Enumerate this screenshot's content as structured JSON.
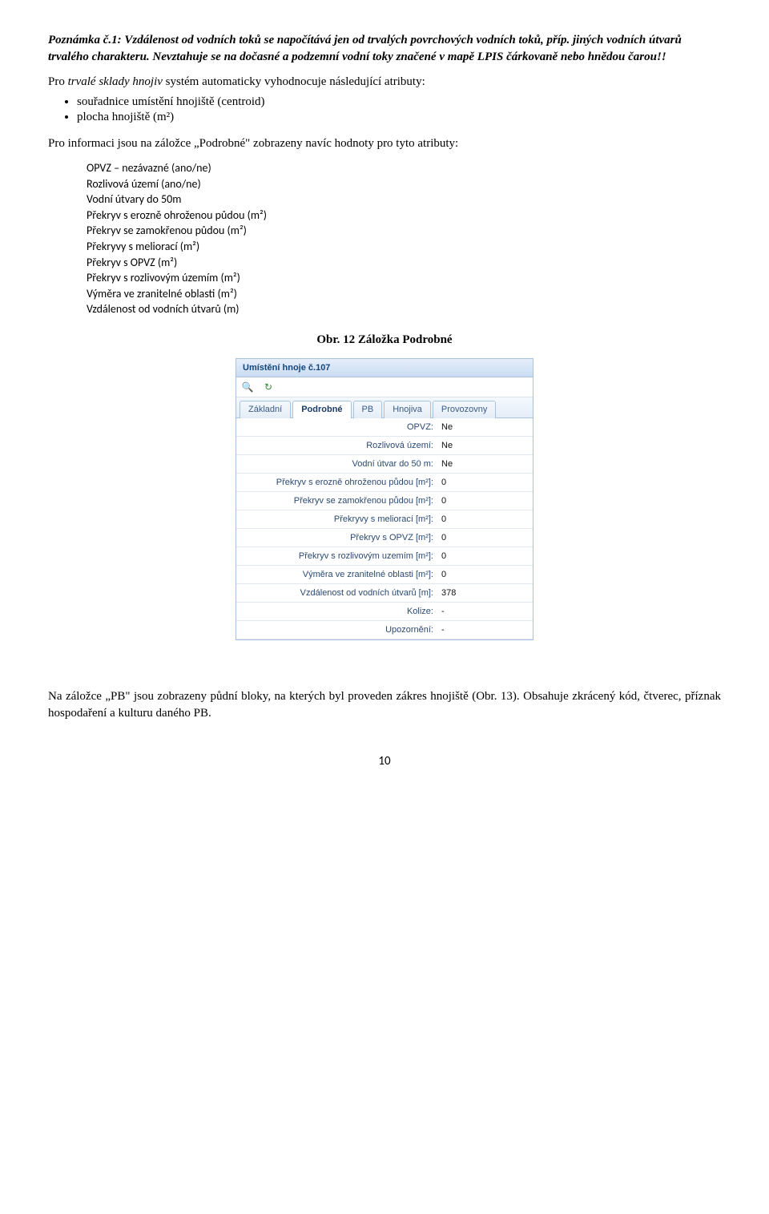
{
  "note": "Poznámka č.1: Vzdálenost od vodních toků se napočítává jen od trvalých povrchových vodních toků, příp. jiných vodních útvarů trvalého charakteru. Nevztahuje se na dočasné a podzemní vodní toky značené v mapě LPIS čárkovaně nebo hnědou čarou!!",
  "para2_pre": "Pro ",
  "para2_it": "trvalé sklady hnojiv",
  "para2_post": " systém automaticky vyhodnocuje následující atributy:",
  "bul1": "souřadnice umístění hnojiště (centroid)",
  "bul2": "plocha hnojiště (m²)",
  "para3": "Pro informaci jsou na záložce „Podrobné\" zobrazeny navíc hodnoty pro tyto atributy:",
  "attrs": {
    "a1": "OPVZ – nezávazné (ano/ne)",
    "a2": "Rozlivová území (ano/ne)",
    "a3": "Vodní útvary do 50m",
    "a4": "Překryv s erozně ohroženou půdou (m²)",
    "a5": "Překryv se zamokřenou půdou (m²)",
    "a6": "Překryvy s meliorací (m²)",
    "a7": "Překryv s OPVZ (m²)",
    "a8": "Překryv s rozlivovým územím (m²)",
    "a9": "Výměra ve zranitelné oblasti (m²)",
    "a10": "Vzdálenost od vodních útvarů (m)"
  },
  "caption": "Obr. 12 Záložka Podrobné",
  "panel": {
    "title": "Umístění hnoje č.107",
    "tabs": {
      "t1": "Základní",
      "t2": "Podrobné",
      "t3": "PB",
      "t4": "Hnojiva",
      "t5": "Provozovny"
    },
    "rows": [
      {
        "label": "OPVZ:",
        "val": "Ne"
      },
      {
        "label": "Rozlivová území:",
        "val": "Ne"
      },
      {
        "label": "Vodní útvar do 50 m:",
        "val": "Ne"
      },
      {
        "label": "Překryv s erozně ohroženou půdou [m²]:",
        "val": "0"
      },
      {
        "label": "Překryv se zamokřenou půdou [m²]:",
        "val": "0"
      },
      {
        "label": "Překryvy s meliorací [m²]:",
        "val": "0"
      },
      {
        "label": "Překryv s OPVZ [m²]:",
        "val": "0"
      },
      {
        "label": "Překryv s rozlivovým uzemím [m²]:",
        "val": "0"
      },
      {
        "label": "Výměra ve zranitelné oblasti [m²]:",
        "val": "0"
      },
      {
        "label": "Vzdálenost od vodních útvarů [m]:",
        "val": "378"
      },
      {
        "label": "Kolize:",
        "val": "-"
      },
      {
        "label": "Upozornění:",
        "val": "-"
      }
    ]
  },
  "para4": "Na záložce „PB\" jsou zobrazeny půdní bloky, na kterých byl proveden zákres hnojiště (Obr. 13). Obsahuje zkrácený kód, čtverec, příznak hospodaření a kulturu daného PB.",
  "page_number": "10"
}
